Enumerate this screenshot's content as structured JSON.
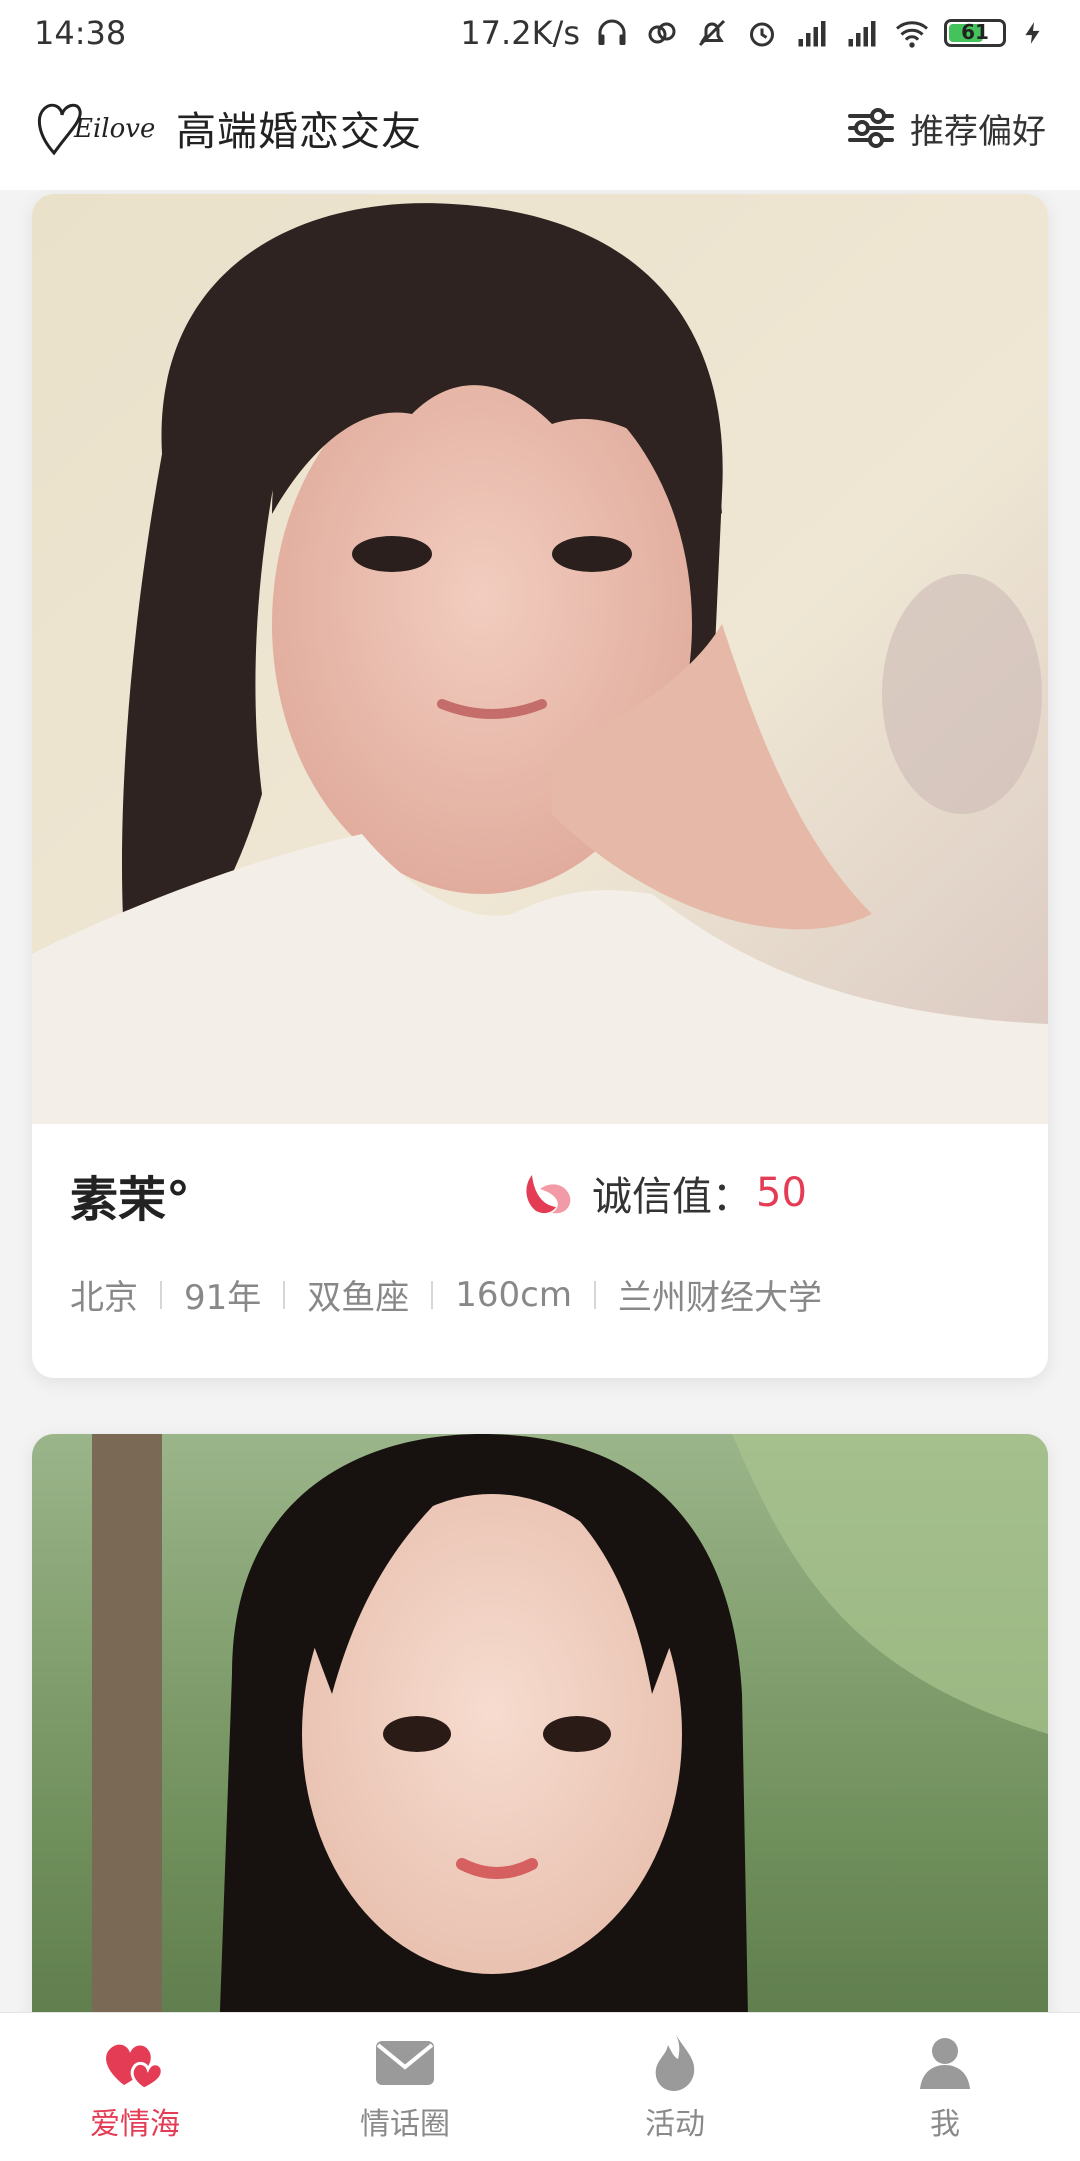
{
  "status_bar": {
    "time": "14:38",
    "net_speed": "17.2K/s",
    "battery_level": "61",
    "battery_fraction": 0.61,
    "icons": [
      "headphones-icon",
      "link-icon",
      "mute-icon",
      "alarm-icon",
      "signal-icon",
      "signal-icon",
      "wifi-icon",
      "battery-icon",
      "charging-icon"
    ]
  },
  "header": {
    "logo_text": "Eilove",
    "title": "高端婚恋交友",
    "preference_label": "推荐偏好",
    "preference_icon": "sliders-icon"
  },
  "profiles": [
    {
      "name": "素茉°",
      "credit_label": "诚信值：",
      "credit_value": "50",
      "details": [
        "北京",
        "91年",
        "双鱼座",
        "160cm",
        "兰州财经大学"
      ]
    }
  ],
  "bottom_nav": [
    {
      "label": "爱情海",
      "icon": "hearts-icon",
      "active": true
    },
    {
      "label": "情话圈",
      "icon": "envelope-icon",
      "active": false
    },
    {
      "label": "活动",
      "icon": "flame-icon",
      "active": false
    },
    {
      "label": "我",
      "icon": "person-icon",
      "active": false
    }
  ],
  "colors": {
    "accent": "#e53c55",
    "battery_green": "#44c25b"
  }
}
